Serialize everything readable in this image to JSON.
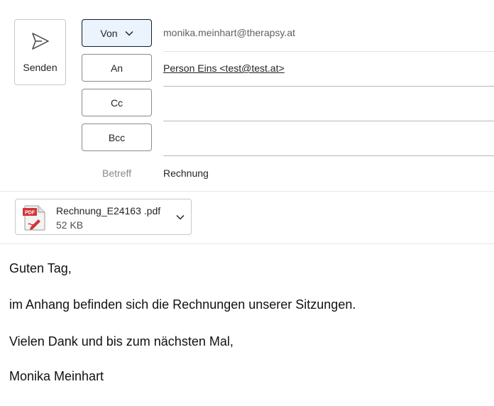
{
  "toolbar": {
    "send_label": "Senden"
  },
  "fields": {
    "from_label": "Von",
    "from_value": "monika.meinhart@therapsy.at",
    "to_label": "An",
    "to_value": "Person Eins <test@test.at>",
    "cc_label": "Cc",
    "bcc_label": "Bcc",
    "subject_label": "Betreff",
    "subject_value": "Rechnung"
  },
  "attachment": {
    "filename": "Rechnung_E24163 .pdf",
    "size": "52 KB",
    "icon": "pdf-file-icon",
    "badge": "PDF"
  },
  "body": {
    "lines": [
      "Guten Tag,",
      "im Anhang befinden sich die Rechnungen unserer Sitzungen.",
      "Vielen Dank und bis zum nächsten Mal,",
      "Monika Meinhart"
    ]
  },
  "colors": {
    "from_button_bg": "#ebf3fc",
    "pdf_red": "#d13438",
    "border": "#8a8a8a"
  }
}
